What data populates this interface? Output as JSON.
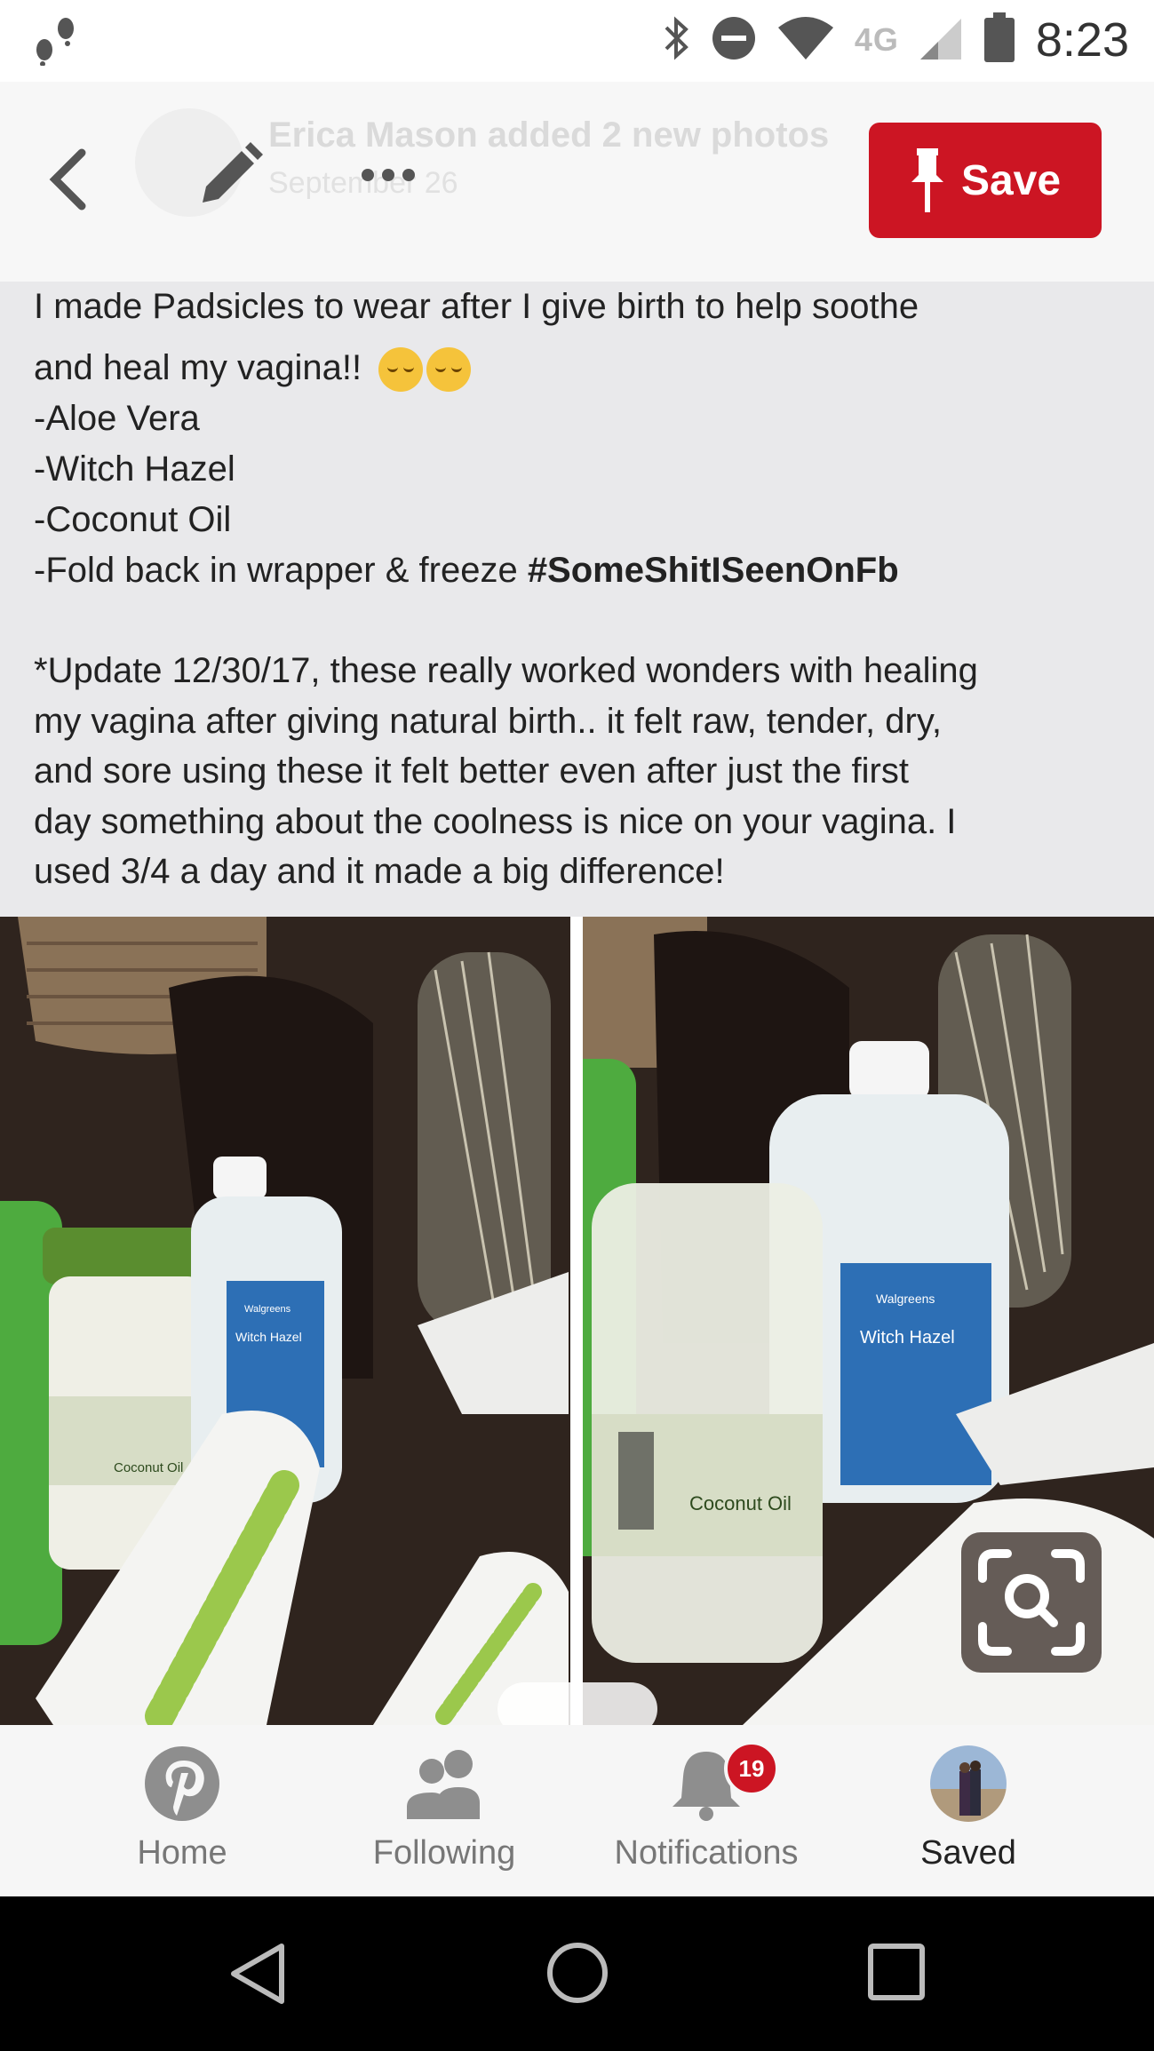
{
  "status_bar": {
    "time": "8:23",
    "network": "4G"
  },
  "top_bar": {
    "ghost_author": "Erica Mason added 2 new photos",
    "ghost_meta": "September 26",
    "save_label": "Save"
  },
  "post": {
    "line1": "I made Padsicles to wear after I give birth to help soothe",
    "line2": "and heal my vagina!!",
    "line3": "-Aloe Vera",
    "line4": "-Witch Hazel",
    "line5": "-Coconut Oil",
    "line6_prefix": "-Fold back in wrapper & freeze ",
    "hashtag": "#SomeShitISeenOnFb",
    "update_line1": "*Update 12/30/17, these really worked wonders with healing",
    "update_line2": "my vagina after giving natural birth.. it felt raw, tender, dry,",
    "update_line3": "and sore using these it felt better even after just the first",
    "update_line4": "day something about the coolness is nice on your vagina. I",
    "update_line5": "used 3/4 a day and it made a big difference!"
  },
  "photos": {
    "left_labels": [
      "Coconut Oil",
      "Witch Hazel",
      "Walgreens"
    ],
    "right_labels": [
      "Coconut Oil",
      "Witch Hazel",
      "Walgreens"
    ]
  },
  "bottom_nav": {
    "items": [
      {
        "label": "Home"
      },
      {
        "label": "Following"
      },
      {
        "label": "Notifications",
        "badge": "19"
      },
      {
        "label": "Saved"
      }
    ]
  },
  "colors": {
    "brand_red": "#cc1523",
    "text_bg": "#e9e9eb"
  }
}
